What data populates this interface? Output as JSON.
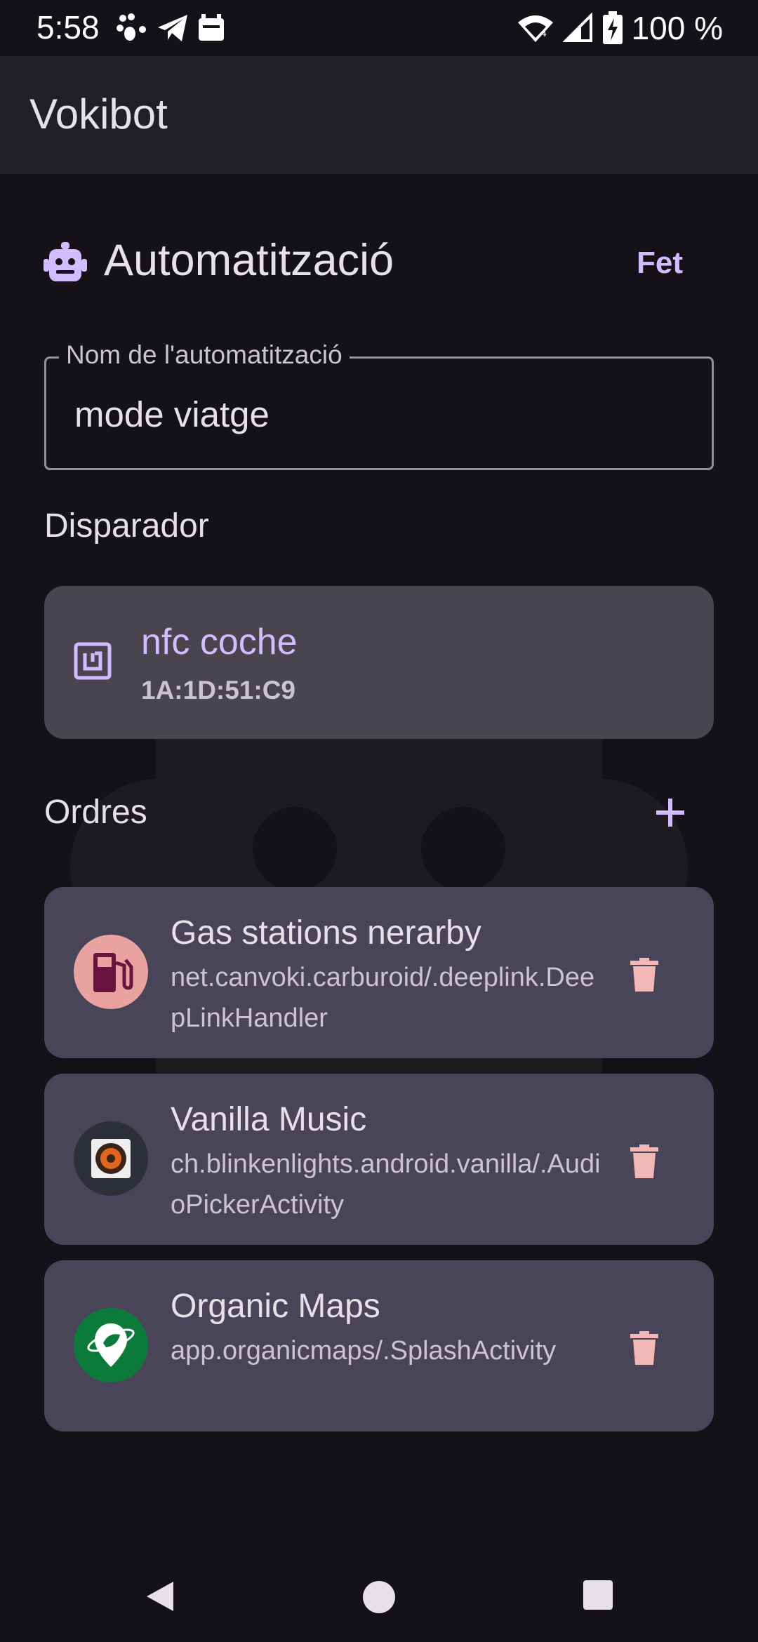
{
  "status_bar": {
    "time": "5:58",
    "battery_text": "100 %"
  },
  "app_bar": {
    "title": "Vokibot"
  },
  "header": {
    "title": "Automatització",
    "done_label": "Fet"
  },
  "name_field": {
    "label": "Nom de l'automatització",
    "value": "mode viatge"
  },
  "trigger_section": {
    "label": "Disparador",
    "card": {
      "title": "nfc coche",
      "subtitle": "1A:1D:51:C9"
    }
  },
  "commands_section": {
    "label": "Ordres",
    "items": [
      {
        "title": "Gas stations nerarby",
        "subtitle": "net.canvoki.carburoid/.deeplink.DeepLinkHandler",
        "icon": "gas-pump-icon"
      },
      {
        "title": "Vanilla Music",
        "subtitle": "ch.blinkenlights.android.vanilla/.AudioPickerActivity",
        "icon": "speaker-icon"
      },
      {
        "title": "Organic Maps",
        "subtitle": "app.organicmaps/.SplashActivity",
        "icon": "map-pin-leaf-icon"
      }
    ]
  },
  "colors": {
    "background": "#141218",
    "surface": "#211f26",
    "primary": "#d0bcff",
    "error": "#f2b8b5",
    "card": "#4a4458"
  }
}
